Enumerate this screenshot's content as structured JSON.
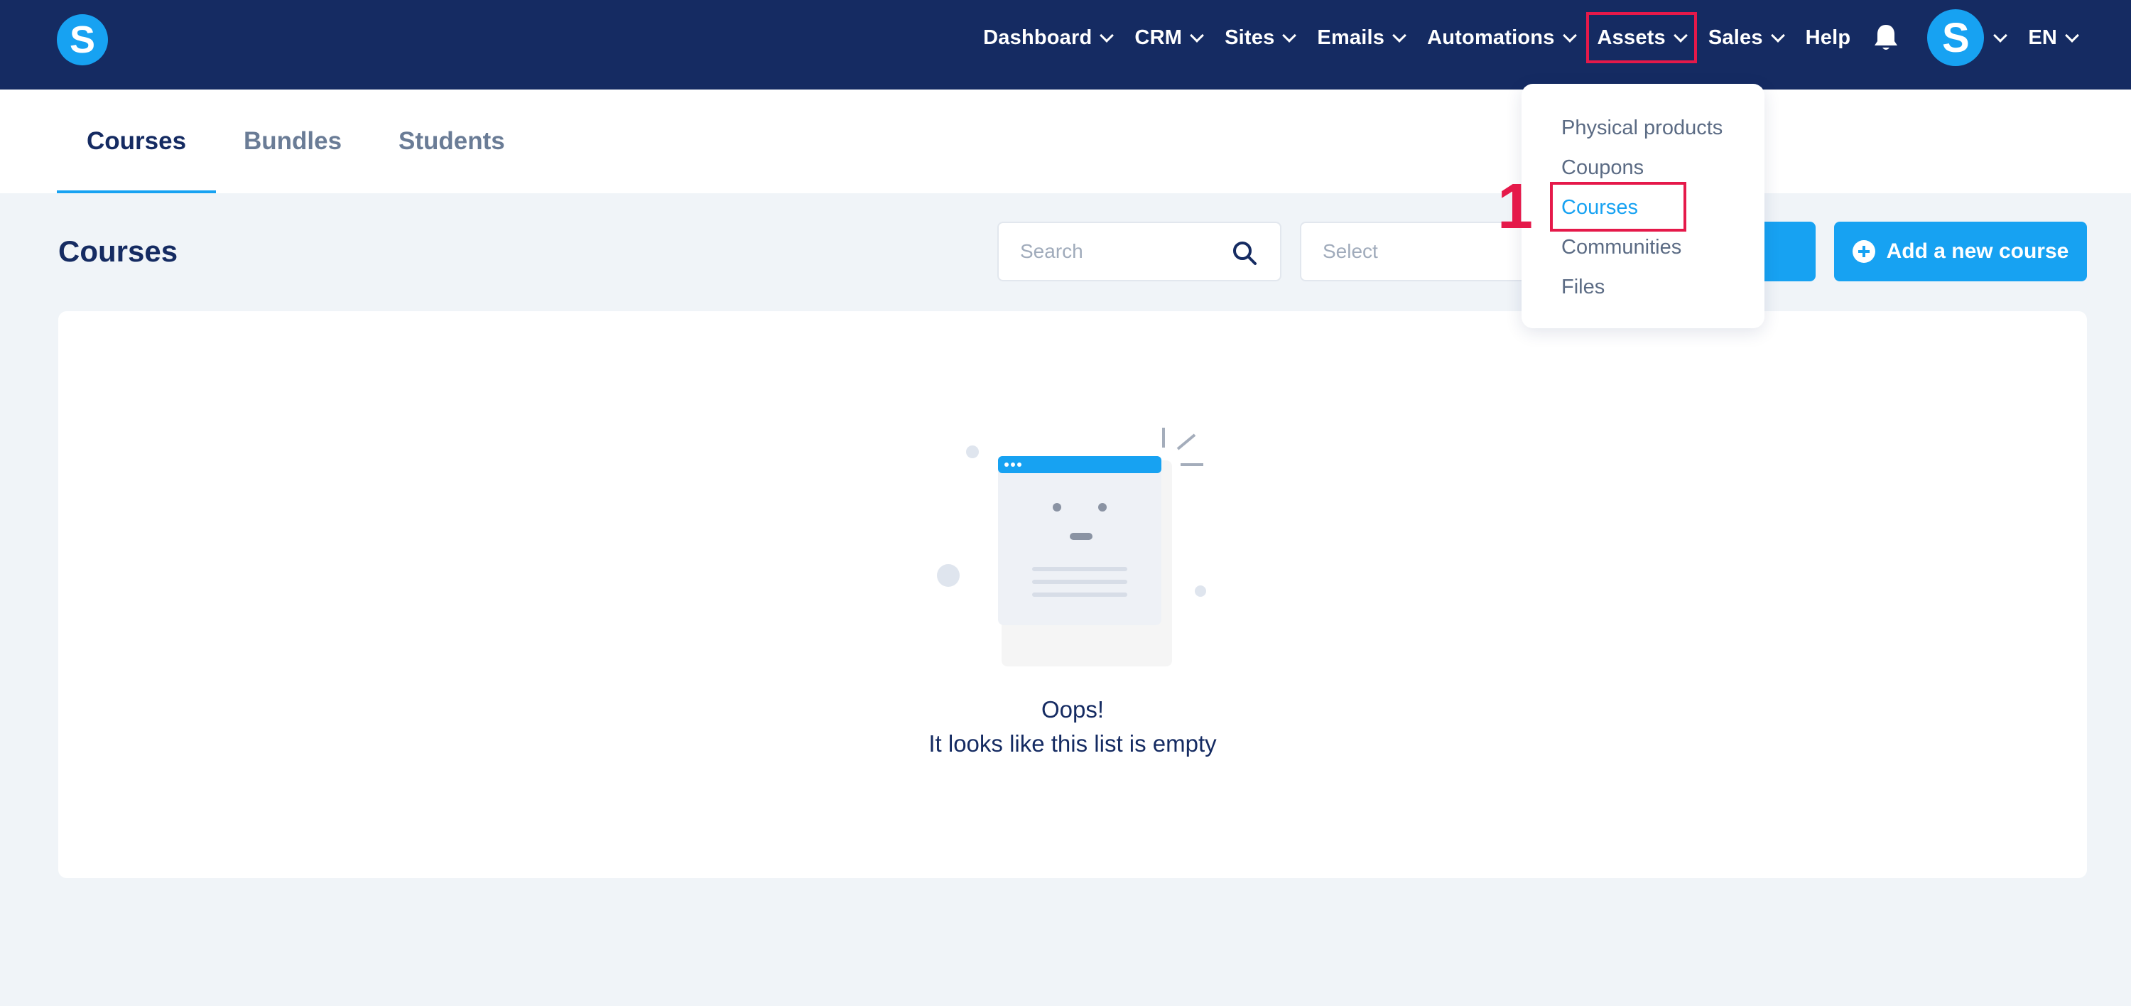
{
  "nav": {
    "logo_letter": "S",
    "items": [
      {
        "label": "Dashboard",
        "has_dropdown": true
      },
      {
        "label": "CRM",
        "has_dropdown": true
      },
      {
        "label": "Sites",
        "has_dropdown": true
      },
      {
        "label": "Emails",
        "has_dropdown": true
      },
      {
        "label": "Automations",
        "has_dropdown": true
      },
      {
        "label": "Assets",
        "has_dropdown": true,
        "highlighted": true
      },
      {
        "label": "Sales",
        "has_dropdown": true
      },
      {
        "label": "Help",
        "has_dropdown": false
      }
    ],
    "avatar_letter": "S",
    "language": "EN"
  },
  "tabs": [
    {
      "label": "Courses",
      "active": true
    },
    {
      "label": "Bundles",
      "active": false
    },
    {
      "label": "Students",
      "active": false
    }
  ],
  "page": {
    "title": "Courses",
    "search_placeholder": "Search",
    "select_placeholder": "Select",
    "add_button_label": "Add a new course"
  },
  "empty_state": {
    "title": "Oops!",
    "subtitle": "It looks like this list is empty"
  },
  "assets_dropdown": {
    "items": [
      {
        "label": "Physical products",
        "active": false
      },
      {
        "label": "Coupons",
        "active": false
      },
      {
        "label": "Courses",
        "active": true
      },
      {
        "label": "Communities",
        "active": false
      },
      {
        "label": "Files",
        "active": false
      }
    ]
  },
  "annotation": {
    "step_number": "1"
  },
  "colors": {
    "nav_background": "#152b62",
    "accent": "#17a2f2",
    "highlight": "#e5194a",
    "page_background": "#f0f4f8"
  }
}
